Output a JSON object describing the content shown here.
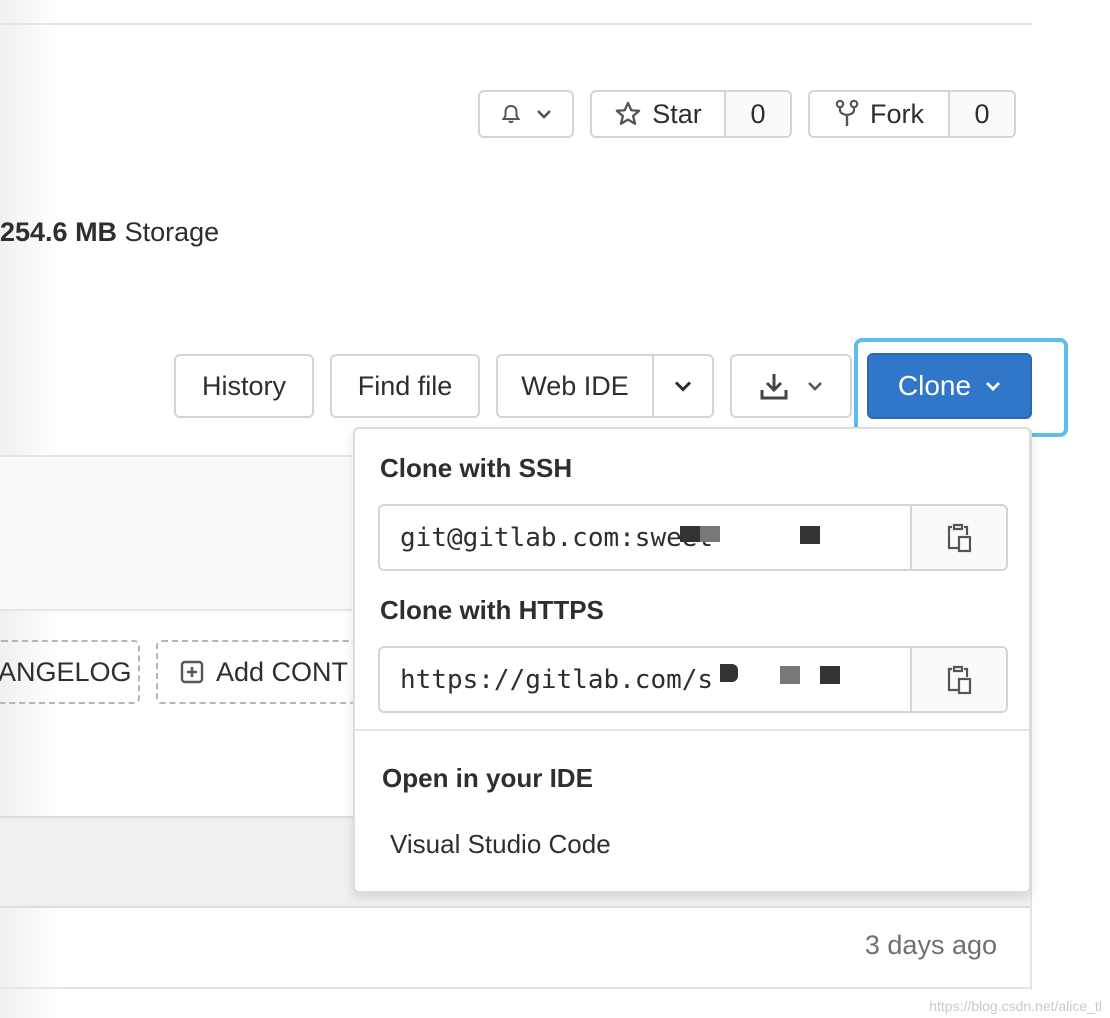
{
  "header": {
    "notification_button": {
      "icon": "bell-icon",
      "caret": "chevron-down-icon"
    },
    "star": {
      "label": "Star",
      "count": "0",
      "icon": "star-icon"
    },
    "fork": {
      "label": "Fork",
      "count": "0",
      "icon": "fork-icon"
    }
  },
  "stats": {
    "storage_value": "254.6 MB",
    "storage_label": "Storage"
  },
  "toolbar": {
    "history": "History",
    "find_file": "Find file",
    "web_ide": "Web IDE",
    "download_icon": "download-icon",
    "clone": "Clone"
  },
  "shortcuts": {
    "changelog": "ANGELOG",
    "add_contributing": "Add CONT"
  },
  "clone_menu": {
    "ssh_heading": "Clone with SSH",
    "ssh_url": "git@gitlab.com:sweet",
    "https_heading": "Clone with HTTPS",
    "https_url": "https://gitlab.com/s",
    "ide_heading": "Open in your IDE",
    "ide_items": [
      "Visual Studio Code"
    ],
    "copy_icon": "clipboard-icon"
  },
  "last_commit": {
    "time_ago": "3 days ago"
  },
  "watermark": "https://blog.csdn.net/alice_tl"
}
